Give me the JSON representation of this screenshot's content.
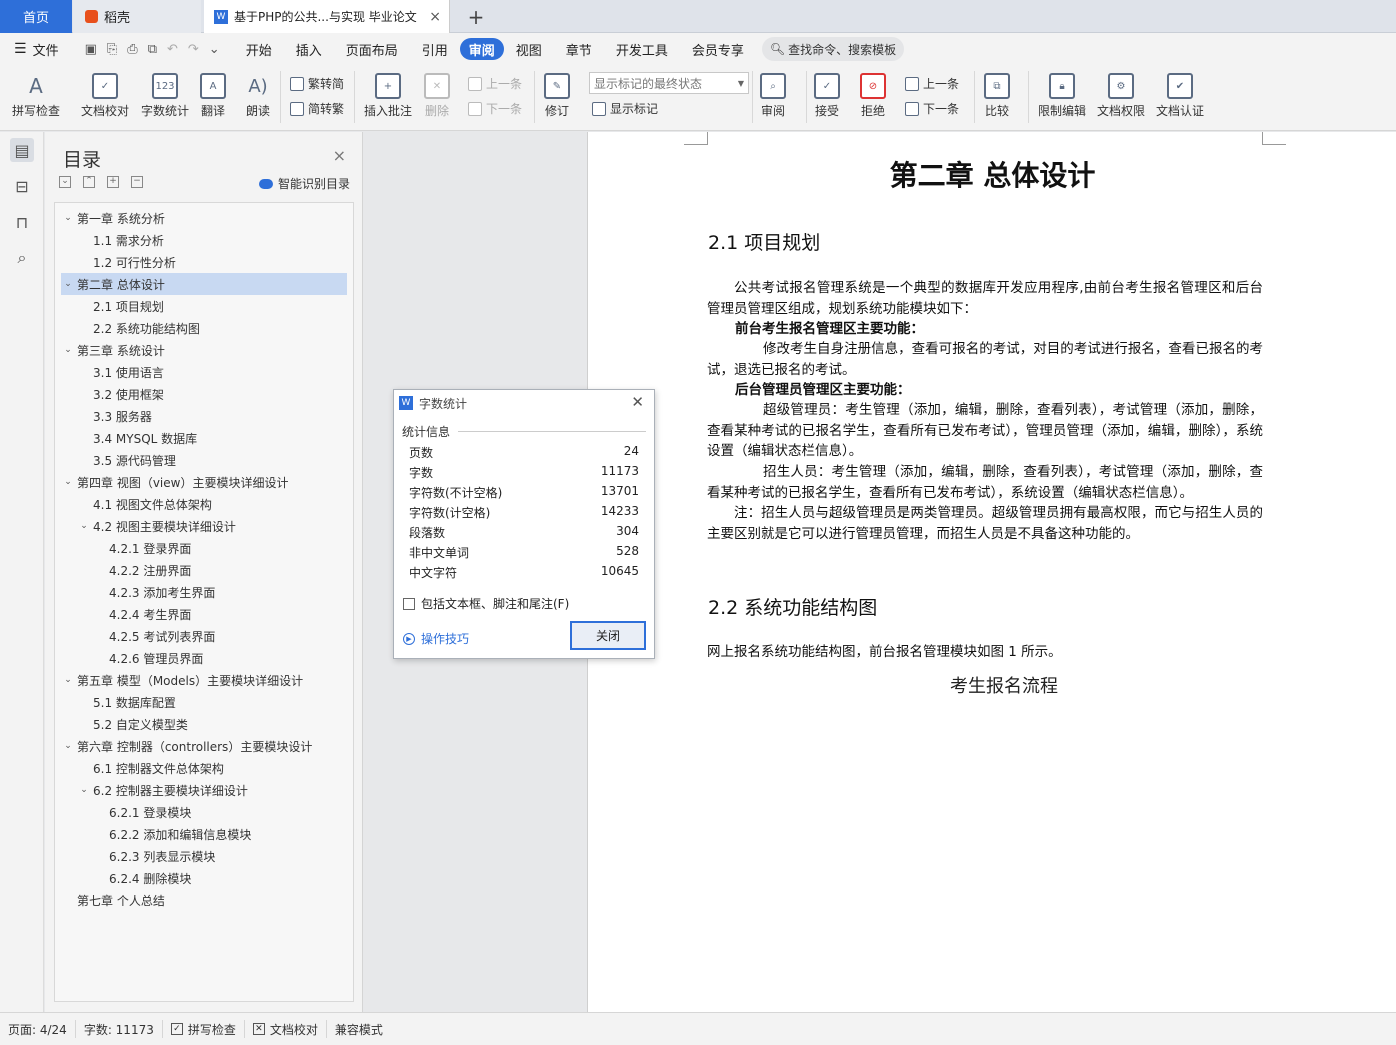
{
  "tabs": {
    "home": "首页",
    "docer": "稻壳",
    "document": "基于PHP的公共...与实现 毕业论文",
    "close": "×",
    "add": "+"
  },
  "menu": {
    "file": "文件",
    "items": [
      "开始",
      "插入",
      "页面布局",
      "引用",
      "审阅",
      "视图",
      "章节",
      "开发工具",
      "会员专享"
    ],
    "active": "审阅",
    "search": "查找命令、搜索模板"
  },
  "ribbon": {
    "spellcheck": "拼写检查",
    "doc_proof": "文档校对",
    "word_count": "字数统计",
    "translate": "翻译",
    "read_aloud": "朗读",
    "to_traditional": "繁转简",
    "to_simplified": "简转繁",
    "insert_comment": "插入批注",
    "delete": "删除",
    "prev": "上一条",
    "next": "下一条",
    "track_changes": "修订",
    "markup_state": "显示标记的最终状态",
    "show_markup": "显示标记",
    "review": "审阅",
    "accept": "接受",
    "reject": "拒绝",
    "prev2": "上一条",
    "next2": "下一条",
    "compare": "比较",
    "restrict_edit": "限制编辑",
    "doc_rights": "文档权限",
    "doc_cert": "文档认证"
  },
  "toc": {
    "title": "目录",
    "smart": "智能识别目录",
    "items": [
      {
        "text": "第一章  系统分析",
        "level": 0,
        "arrow": "v"
      },
      {
        "text": "1.1    需求分析",
        "level": 1,
        "arrow": ""
      },
      {
        "text": "1.2    可行性分析",
        "level": 1,
        "arrow": ""
      },
      {
        "text": "第二章  总体设计",
        "level": 0,
        "arrow": "v",
        "selected": true
      },
      {
        "text": "2.1    项目规划",
        "level": 1,
        "arrow": ""
      },
      {
        "text": "2.2    系统功能结构图",
        "level": 1,
        "arrow": ""
      },
      {
        "text": "第三章  系统设计",
        "level": 0,
        "arrow": "v"
      },
      {
        "text": "3.1  使用语言",
        "level": 1,
        "arrow": ""
      },
      {
        "text": "3.2  使用框架",
        "level": 1,
        "arrow": ""
      },
      {
        "text": "3.3  服务器",
        "level": 1,
        "arrow": ""
      },
      {
        "text": "3.4    MYSQL 数据库",
        "level": 1,
        "arrow": ""
      },
      {
        "text": "3.5  源代码管理",
        "level": 1,
        "arrow": ""
      },
      {
        "text": "第四章   视图（view）主要模块详细设计",
        "level": 0,
        "arrow": "v"
      },
      {
        "text": "4.1    视图文件总体架构",
        "level": 1,
        "arrow": ""
      },
      {
        "text": "4.2 视图主要模块详细设计",
        "level": 1,
        "arrow": "v"
      },
      {
        "text": "4.2.1  登录界面",
        "level": 2,
        "arrow": ""
      },
      {
        "text": "4.2.2  注册界面",
        "level": 2,
        "arrow": ""
      },
      {
        "text": "4.2.3  添加考生界面",
        "level": 2,
        "arrow": ""
      },
      {
        "text": "4.2.4  考生界面",
        "level": 2,
        "arrow": ""
      },
      {
        "text": "4.2.5  考试列表界面",
        "level": 2,
        "arrow": ""
      },
      {
        "text": "4.2.6  管理员界面",
        "level": 2,
        "arrow": ""
      },
      {
        "text": "第五章   模型（Models）主要模块详细设计",
        "level": 0,
        "arrow": "v"
      },
      {
        "text": "5.1  数据库配置",
        "level": 1,
        "arrow": ""
      },
      {
        "text": "5.2  自定义模型类",
        "level": 1,
        "arrow": ""
      },
      {
        "text": "第六章  控制器（controllers）主要模块设计",
        "level": 0,
        "arrow": "v"
      },
      {
        "text": "6.1  控制器文件总体架构",
        "level": 1,
        "arrow": ""
      },
      {
        "text": "6.2  控制器主要模块详细设计",
        "level": 1,
        "arrow": "v"
      },
      {
        "text": "6.2.1  登录模块",
        "level": 2,
        "arrow": ""
      },
      {
        "text": "6.2.2  添加和编辑信息模块",
        "level": 2,
        "arrow": ""
      },
      {
        "text": "6.2.3  列表显示模块",
        "level": 2,
        "arrow": ""
      },
      {
        "text": "6.2.4  删除模块",
        "level": 2,
        "arrow": ""
      },
      {
        "text": "第七章  个人总结",
        "level": 0,
        "arrow": ""
      }
    ]
  },
  "document": {
    "chapter_title": "第二章  总体设计",
    "sec1": "2.1    项目规划",
    "p1": "公共考试报名管理系统是一个典型的数据库开发应用程序,由前台考生报名管理区和后台管理员管理区组成，规划系统功能模块如下：",
    "p2_heading": "前台考生报名管理区主要功能：",
    "p2": "修改考生自身注册信息，查看可报名的考试，对目的考试进行报名，查看已报名的考试，退选已报名的考试。",
    "p3_heading": "后台管理员管理区主要功能：",
    "p3": "超级管理员：考生管理（添加，编辑，删除，查看列表），考试管理（添加，删除，查看某种考试的已报名学生，查看所有已发布考试），管理员管理（添加，编辑，删除），系统设置（编辑状态栏信息）。",
    "p4": "招生人员：考生管理（添加，编辑，删除，查看列表），考试管理（添加，删除，查看某种考试的已报名学生，查看所有已发布考试），系统设置（编辑状态栏信息）。",
    "p5": "注：招生人员与超级管理员是两类管理员。超级管理员拥有最高权限，而它与招生人员的主要区别就是它可以进行管理员管理，而招生人员是不具备这种功能的。",
    "sec2": "2.2    系统功能结构图",
    "p6": "网上报名系统功能结构图，前台报名管理模块如图 1 所示。",
    "figure_caption": "考生报名流程"
  },
  "dialog": {
    "title": "字数统计",
    "group": "统计信息",
    "stats": [
      {
        "label": "页数",
        "value": "24"
      },
      {
        "label": "字数",
        "value": "11173"
      },
      {
        "label": "字符数(不计空格)",
        "value": "13701"
      },
      {
        "label": "字符数(计空格)",
        "value": "14233"
      },
      {
        "label": "段落数",
        "value": "304"
      },
      {
        "label": "非中文单词",
        "value": "528"
      },
      {
        "label": "中文字符",
        "value": "10645"
      }
    ],
    "include_label": "包括文本框、脚注和尾注(F)",
    "tips": "操作技巧",
    "close_button": "关闭"
  },
  "status": {
    "page": "页面: 4/24",
    "words": "字数: 11173",
    "spell": "拼写检查",
    "proof": "文档校对",
    "compat": "兼容模式"
  },
  "colors": {
    "accent": "#2e6fd9",
    "toc_selected": "#c8d9f2"
  }
}
